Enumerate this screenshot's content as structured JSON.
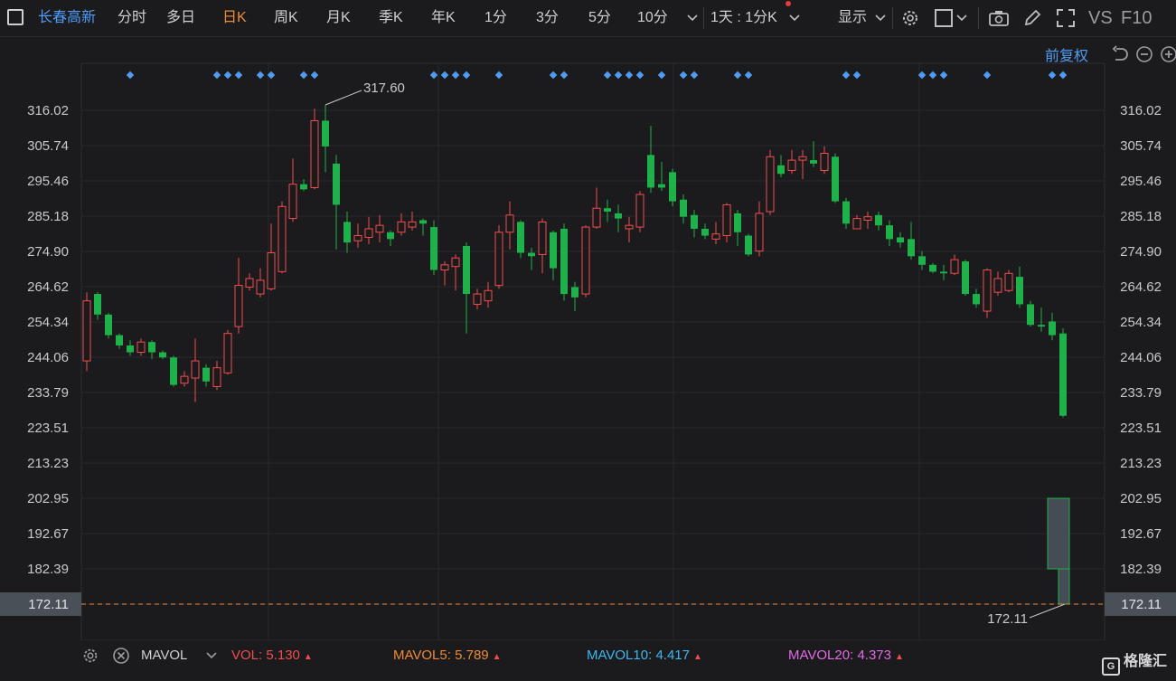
{
  "toolbar": {
    "stock_name": "长春高新",
    "tabs": [
      "分时",
      "多日",
      "日K",
      "周K",
      "月K",
      "季K",
      "年K",
      "1分",
      "3分",
      "5分",
      "10分"
    ],
    "active_tab": "日K",
    "interval_select": "1天 : 1分K",
    "display_label": "显示",
    "vs_label": "VS",
    "f10_label": "F10"
  },
  "adjust_label": "前复权",
  "colors": {
    "up": "#f24d4d",
    "down": "#1fb14a",
    "accent": "#f08a36",
    "link": "#4f9cf5",
    "ma5": "#f08a36",
    "ma10": "#3fb7f0",
    "ma20": "#e26be6"
  },
  "chart_data": {
    "type": "candlestick",
    "y_ticks": [
      "316.02",
      "305.74",
      "295.46",
      "285.18",
      "274.90",
      "264.62",
      "254.34",
      "244.06",
      "233.79",
      "223.51",
      "213.23",
      "202.95",
      "192.67",
      "182.39",
      "172.11"
    ],
    "ylim": [
      172.11,
      316.02
    ],
    "max_label": "317.60",
    "min_label": "172.11",
    "current_price": "172.11",
    "candles": [
      [
        243.0,
        260.5,
        263.0,
        240.0
      ],
      [
        262.5,
        256.5,
        263.0,
        255.0
      ],
      [
        256.5,
        250.5,
        257.0,
        249.5
      ],
      [
        250.5,
        247.5,
        251.0,
        246.5
      ],
      [
        247.5,
        245.5,
        249.0,
        244.5
      ],
      [
        245.5,
        248.5,
        249.5,
        244.5
      ],
      [
        248.5,
        245.5,
        249.0,
        243.5
      ],
      [
        245.5,
        244.0,
        246.0,
        243.5
      ],
      [
        244.0,
        236.0,
        244.5,
        235.5
      ],
      [
        236.5,
        238.5,
        240.0,
        235.5
      ],
      [
        238.0,
        243.0,
        249.5,
        231.0
      ],
      [
        241.0,
        237.0,
        242.0,
        235.5
      ],
      [
        235.5,
        241.0,
        243.0,
        234.5
      ],
      [
        239.5,
        251.0,
        252.0,
        239.0
      ],
      [
        253.0,
        265.0,
        273.0,
        251.0
      ],
      [
        264.5,
        267.0,
        268.5,
        263.5
      ],
      [
        262.5,
        266.5,
        270.0,
        261.5
      ],
      [
        264.0,
        274.5,
        283.0,
        263.5
      ],
      [
        269.0,
        288.0,
        289.5,
        268.5
      ],
      [
        284.5,
        294.5,
        302.0,
        283.5
      ],
      [
        294.5,
        293.0,
        296.0,
        292.5
      ],
      [
        293.5,
        313.0,
        316.5,
        293.0
      ],
      [
        313.0,
        305.5,
        317.6,
        298.0
      ],
      [
        300.5,
        288.5,
        303.0,
        275.5
      ],
      [
        283.5,
        277.5,
        286.5,
        274.5
      ],
      [
        278.0,
        279.5,
        283.0,
        276.0
      ],
      [
        279.0,
        281.5,
        285.0,
        277.0
      ],
      [
        280.5,
        282.5,
        285.5,
        277.5
      ],
      [
        280.5,
        278.5,
        281.0,
        276.5
      ],
      [
        280.5,
        283.5,
        286.0,
        279.5
      ],
      [
        282.0,
        283.5,
        286.5,
        281.0
      ],
      [
        284.0,
        283.0,
        284.5,
        279.5
      ],
      [
        282.0,
        269.5,
        284.0,
        268.0
      ],
      [
        269.5,
        271.0,
        272.0,
        265.0
      ],
      [
        270.5,
        273.0,
        274.0,
        263.5
      ],
      [
        276.5,
        262.5,
        277.5,
        251.0
      ],
      [
        259.5,
        262.5,
        264.0,
        258.0
      ],
      [
        260.5,
        263.5,
        266.0,
        258.5
      ],
      [
        265.0,
        280.5,
        282.5,
        264.0
      ],
      [
        280.5,
        285.5,
        289.5,
        275.5
      ],
      [
        283.5,
        274.5,
        284.0,
        273.0
      ],
      [
        274.5,
        273.5,
        276.0,
        269.5
      ],
      [
        274.0,
        283.5,
        284.5,
        268.5
      ],
      [
        280.5,
        270.0,
        281.0,
        266.5
      ],
      [
        281.5,
        262.5,
        283.0,
        260.5
      ],
      [
        264.5,
        261.5,
        266.0,
        257.5
      ],
      [
        262.5,
        282.0,
        282.5,
        261.5
      ],
      [
        282.0,
        287.5,
        293.5,
        281.5
      ],
      [
        287.5,
        286.5,
        290.0,
        283.5
      ],
      [
        286.0,
        284.5,
        288.5,
        280.5
      ],
      [
        281.5,
        282.5,
        285.0,
        277.5
      ],
      [
        282.0,
        291.5,
        292.5,
        280.5
      ],
      [
        303.0,
        293.5,
        311.5,
        292.0
      ],
      [
        294.5,
        293.5,
        301.0,
        292.5
      ],
      [
        298.0,
        289.5,
        299.0,
        288.0
      ],
      [
        290.0,
        285.0,
        291.5,
        283.0
      ],
      [
        285.5,
        281.5,
        287.0,
        279.0
      ],
      [
        281.5,
        279.5,
        283.0,
        278.5
      ],
      [
        278.5,
        280.0,
        283.5,
        277.0
      ],
      [
        279.5,
        288.5,
        289.0,
        277.5
      ],
      [
        286.0,
        280.5,
        287.0,
        276.5
      ],
      [
        279.5,
        274.0,
        280.0,
        273.5
      ],
      [
        275.0,
        286.0,
        289.5,
        273.5
      ],
      [
        286.5,
        302.5,
        304.5,
        285.5
      ],
      [
        300.0,
        297.5,
        303.0,
        296.5
      ],
      [
        298.5,
        301.5,
        304.5,
        297.5
      ],
      [
        301.5,
        302.5,
        304.5,
        296.0
      ],
      [
        301.5,
        300.5,
        307.0,
        299.5
      ],
      [
        298.5,
        303.5,
        305.5,
        297.5
      ],
      [
        302.5,
        289.5,
        303.5,
        289.0
      ],
      [
        289.5,
        283.0,
        290.5,
        281.5
      ],
      [
        281.5,
        284.5,
        285.5,
        281.5
      ],
      [
        284.0,
        285.0,
        286.5,
        281.5
      ],
      [
        285.5,
        282.5,
        286.5,
        281.0
      ],
      [
        282.5,
        278.5,
        284.0,
        276.5
      ],
      [
        279.0,
        277.5,
        280.5,
        276.0
      ],
      [
        278.5,
        273.5,
        283.5,
        272.5
      ],
      [
        273.5,
        271.0,
        275.0,
        269.5
      ],
      [
        271.0,
        269.0,
        271.5,
        268.5
      ],
      [
        269.0,
        268.5,
        271.0,
        266.5
      ],
      [
        268.5,
        272.5,
        274.0,
        268.0
      ],
      [
        272.0,
        262.5,
        272.5,
        262.0
      ],
      [
        262.5,
        259.5,
        264.0,
        258.5
      ],
      [
        257.5,
        269.5,
        270.0,
        255.5
      ],
      [
        263.0,
        267.0,
        269.0,
        262.0
      ],
      [
        263.5,
        268.5,
        269.5,
        263.0
      ],
      [
        267.5,
        259.5,
        270.5,
        258.5
      ],
      [
        259.5,
        253.5,
        260.5,
        253.0
      ],
      [
        253.5,
        253.0,
        258.5,
        251.5
      ],
      [
        254.5,
        250.5,
        257.0,
        249.0
      ],
      [
        251.0,
        227.0,
        252.5,
        226.5
      ]
    ],
    "volume_bars": [
      {
        "open": 202.95,
        "close": 182.39
      },
      {
        "open": 182.39,
        "close": 172.11
      }
    ],
    "markers": [
      4,
      12,
      13,
      14,
      16,
      17,
      20,
      21,
      32,
      33,
      34,
      35,
      38,
      43,
      44,
      48,
      49,
      50,
      51,
      53,
      55,
      56,
      60,
      61,
      70,
      71,
      77,
      78,
      79,
      83,
      89,
      90
    ]
  },
  "indicator_bar": {
    "name": "MAVOL",
    "vol_label": "VOL:",
    "vol_value": "5.130",
    "ma5_label": "MAVOL5:",
    "ma5_value": "5.789",
    "ma10_label": "MAVOL10:",
    "ma10_value": "4.417",
    "ma20_label": "MAVOL20:",
    "ma20_value": "4.373"
  },
  "logo": {
    "text": "格隆汇",
    "mark": "G"
  }
}
